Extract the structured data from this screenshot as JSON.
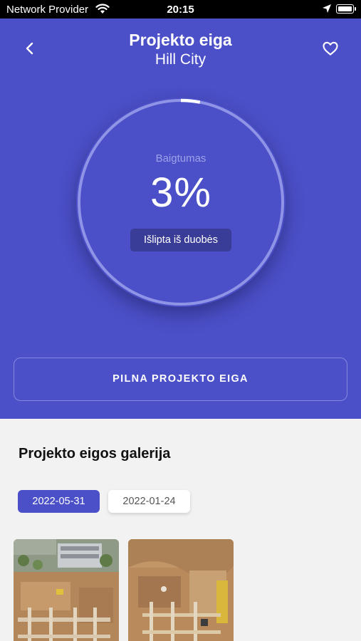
{
  "status_bar": {
    "carrier": "Network Provider",
    "time": "20:15"
  },
  "header": {
    "title": "Projekto eiga",
    "subtitle": "Hill City",
    "back_icon": "chevron-left-icon",
    "favorite_icon": "heart-outline-icon"
  },
  "progress": {
    "label": "Baigtumas",
    "value_text": "3%",
    "fraction": 0.03,
    "stage": "Išlipta iš duobės"
  },
  "full_progress_button": "PILNA PROJEKTO EIGA",
  "gallery": {
    "title": "Projekto eigos galerija",
    "dates": [
      {
        "label": "2022-05-31",
        "selected": true
      },
      {
        "label": "2022-01-24",
        "selected": false
      }
    ],
    "photos": [
      "construction-site-photo",
      "construction-site-photo"
    ]
  },
  "colors": {
    "primary": "#4b50c8",
    "badge": "#3a3d98",
    "background": "#f2f2f2"
  }
}
